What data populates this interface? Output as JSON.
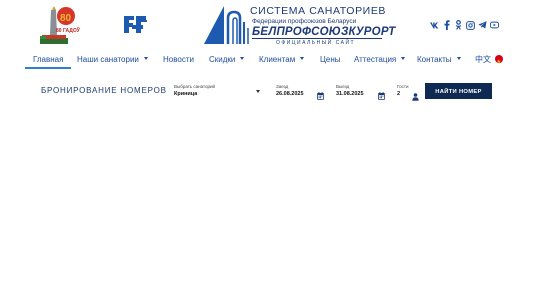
{
  "header": {
    "anniversary_emblem": {
      "icon": "victory-80-years-emblem-icon",
      "text": "80 ГАДОЎ"
    },
    "fpb_logo": {
      "icon": "fpb-logo-icon"
    },
    "brand": {
      "line1": "СИСТЕМА САНАТОРИЕВ",
      "line2": "Федерации профсоюзов Беларуси",
      "line3": "БЕЛПРОФСОЮЗКУРОРТ",
      "line4": "ОФИЦИАЛЬНЫЙ САЙТ"
    },
    "social_icons": [
      "vk-icon",
      "facebook-icon",
      "odnoklassniki-icon",
      "instagram-icon",
      "telegram-icon",
      "youtube-icon"
    ]
  },
  "nav": {
    "items": [
      {
        "label": "Главная",
        "dropdown": false,
        "active": true
      },
      {
        "label": "Наши санатории",
        "dropdown": true
      },
      {
        "label": "Новости",
        "dropdown": false
      },
      {
        "label": "Скидки",
        "dropdown": true
      },
      {
        "label": "Клиентам",
        "dropdown": true
      },
      {
        "label": "Цены",
        "dropdown": false
      },
      {
        "label": "Аттестация",
        "dropdown": true
      },
      {
        "label": "Контакты",
        "dropdown": true
      },
      {
        "label": "中文",
        "dropdown": false
      }
    ]
  },
  "booking": {
    "title": "БРОНИРОВАНИЕ НОМЕРОВ",
    "sanatorium": {
      "label": "Выбрать санаторий",
      "value": "Криница"
    },
    "checkin": {
      "label": "Заезд",
      "value": "26.08.2025"
    },
    "checkout": {
      "label": "Выезд",
      "value": "31.08.2025"
    },
    "guests": {
      "label": "Гости",
      "value": "2"
    },
    "button": "НАЙТИ НОМЕР"
  },
  "colors": {
    "brand_blue": "#1e3a78",
    "link_blue": "#1e4ea0",
    "button_bg": "#0f2a52",
    "active_underline": "#2f7fd0"
  }
}
